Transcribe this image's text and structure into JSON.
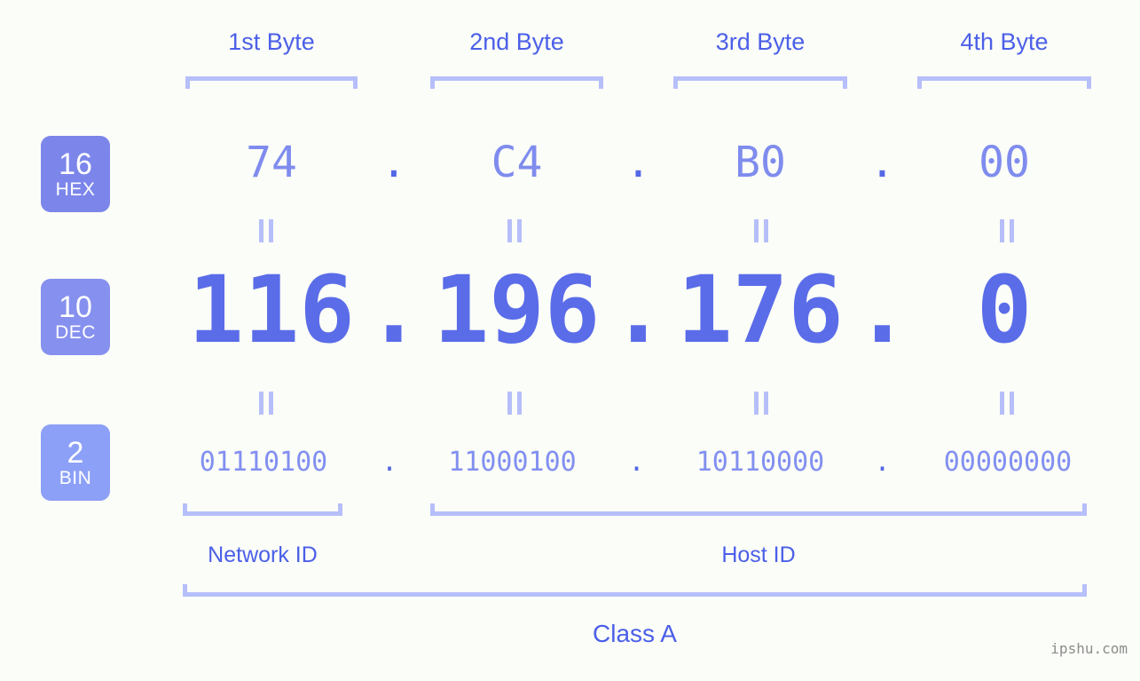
{
  "meta": {
    "background_color": "#FBFDF8",
    "accent_strong": "#4B5FE8",
    "accent_light": "#B6BFFA",
    "badge_hex_color": "#7C86EA",
    "badge_dec_color": "#8690EE",
    "badge_bin_color": "#8CA0F7",
    "watermark": "ipshu.com"
  },
  "header": {
    "byte_labels": [
      "1st Byte",
      "2nd Byte",
      "3rd Byte",
      "4th Byte"
    ]
  },
  "radix_badges": [
    {
      "number": "16",
      "abbr": "HEX"
    },
    {
      "number": "10",
      "abbr": "DEC"
    },
    {
      "number": "2",
      "abbr": "BIN"
    }
  ],
  "rows": {
    "hex": {
      "radix": "16",
      "name": "HEX",
      "octets": [
        "74",
        "C4",
        "B0",
        "00"
      ],
      "separator": "."
    },
    "dec": {
      "radix": "10",
      "name": "DEC",
      "octets": [
        "116",
        "196",
        "176",
        "0"
      ],
      "separator": "."
    },
    "bin": {
      "radix": "2",
      "name": "BIN",
      "octets": [
        "01110100",
        "11000100",
        "10110000",
        "00000000"
      ],
      "separator": "."
    }
  },
  "equals_marks": {
    "glyph": "=",
    "count_per_gap": 4,
    "gaps": 2
  },
  "footer": {
    "network_id_label": "Network ID",
    "host_id_label": "Host ID",
    "class_label": "Class A"
  },
  "address": {
    "dotted_decimal": "116.196.176.0",
    "dotted_hex": "74.C4.B0.00",
    "dotted_binary": "01110100.11000100.10110000.00000000",
    "class": "Class A"
  }
}
